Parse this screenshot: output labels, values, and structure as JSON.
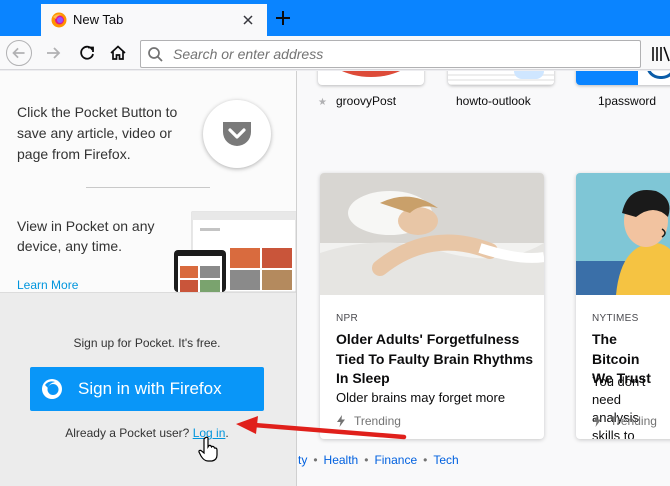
{
  "tab": {
    "title": "New Tab"
  },
  "urlbar": {
    "placeholder": "Search or enter address"
  },
  "topsites": [
    {
      "label": "groovyPost"
    },
    {
      "label": "howto-outlook"
    },
    {
      "label": "1password"
    }
  ],
  "stories": [
    {
      "source": "NPR",
      "title": "Older Adults' Forgetfulness Tied To Faulty Brain Rhythms In Sleep",
      "excerpt": "Older brains may forget more",
      "context": "Trending"
    },
    {
      "source": "NYTIMES",
      "title": "The Bitcoin We Trust",
      "excerpt": "You don't need analysis skills to",
      "context": "Trending"
    }
  ],
  "topics": {
    "partial": "ty",
    "items": [
      "Health",
      "Finance",
      "Tech"
    ]
  },
  "pocket": {
    "intro_text": "Click the Pocket Button to save any article, video or page from Firefox.",
    "view_text": "View in Pocket on any device, any time.",
    "learn_more": "Learn More",
    "signup_text": "Sign up for Pocket. It's free.",
    "signin_label": "Sign in with Firefox",
    "already_user": "Already a Pocket user?",
    "login_link": "Log in",
    "login_suffix": "."
  },
  "colors": {
    "accent": "#0a84ff",
    "signin_button": "#0996f8",
    "link": "#0095dd",
    "annotation_arrow": "#e0201b"
  }
}
